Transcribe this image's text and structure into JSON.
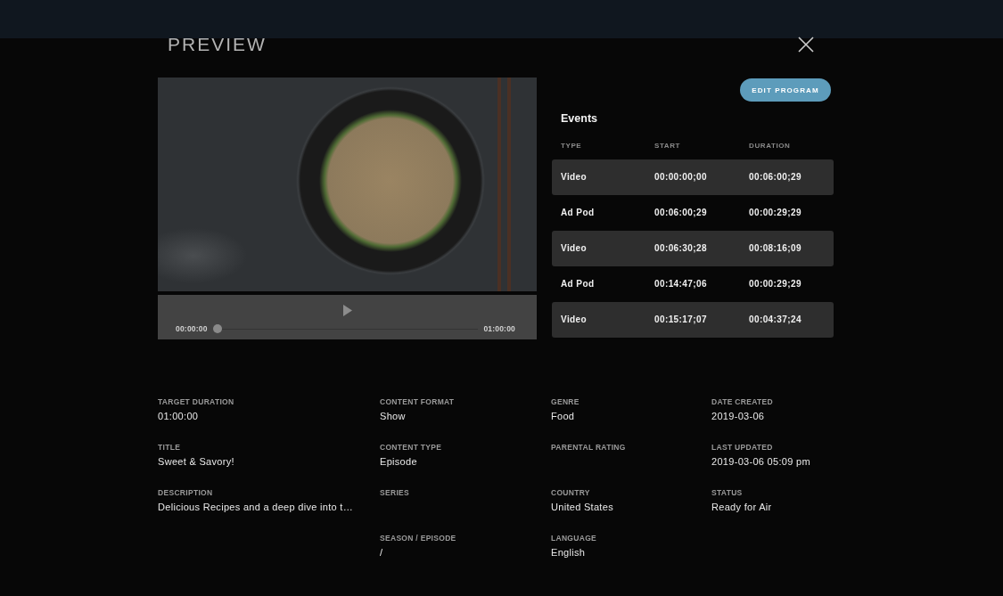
{
  "dialog": {
    "title": "PREVIEW",
    "player": {
      "current_time": "00:00:00",
      "total_time": "01:00:00",
      "level": 0
    },
    "edit_button": "EDIT PROGRAM",
    "events": {
      "title": "Events",
      "columns": [
        "TYPE",
        "START",
        "DURATION"
      ],
      "rows": [
        {
          "type": "Video",
          "start": "00:00:00;00",
          "duration": "00:06:00;29"
        },
        {
          "type": "Ad Pod",
          "start": "00:06:00;29",
          "duration": "00:00:29;29"
        },
        {
          "type": "Video",
          "start": "00:06:30;28",
          "duration": "00:08:16;09"
        },
        {
          "type": "Ad Pod",
          "start": "00:14:47;06",
          "duration": "00:00:29;29"
        },
        {
          "type": "Video",
          "start": "00:15:17;07",
          "duration": "00:04:37;24"
        }
      ]
    },
    "details": {
      "columns": [
        [
          {
            "label": "TARGET DURATION",
            "value": "01:00:00"
          },
          {
            "label": "TITLE",
            "value": "Sweet & Savory!"
          },
          {
            "label": "DESCRIPTION",
            "value": "Delicious Recipes and a deep dive into t…"
          }
        ],
        [
          {
            "label": "CONTENT FORMAT",
            "value": "Show"
          },
          {
            "label": "CONTENT TYPE",
            "value": "Episode"
          },
          {
            "label": "SERIES"
          },
          {
            "label": "SEASON / EPISODE",
            "value": "/"
          }
        ],
        [
          {
            "label": "GENRE",
            "value": "Food"
          },
          {
            "label": "PARENTAL RATING"
          },
          {
            "label": "COUNTRY",
            "value": "United States"
          },
          {
            "label": "LANGUAGE",
            "value": "English"
          }
        ],
        [
          {
            "label": "DATE CREATED",
            "value": "2019-03-06"
          },
          {
            "label": "LAST UPDATED",
            "value": "2019-03-06 05:09 pm"
          },
          {
            "label": "STATUS",
            "value": "Ready for Air"
          }
        ]
      ]
    }
  }
}
